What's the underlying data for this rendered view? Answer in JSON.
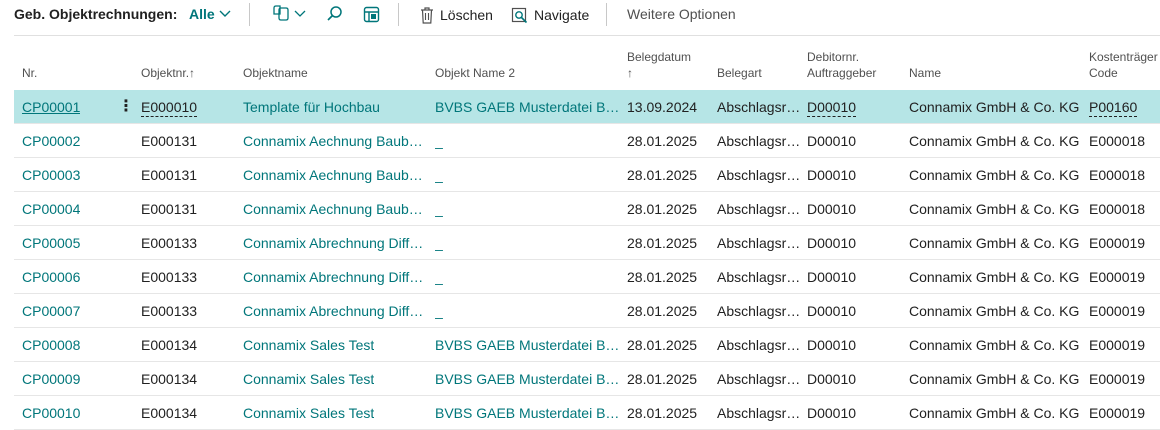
{
  "toolbar": {
    "title": "Geb. Objektrechnungen:",
    "filter_label": "Alle",
    "delete_label": "Löschen",
    "navigate_label": "Navigate",
    "more_label": "Weitere Optionen"
  },
  "columns": {
    "nr": "Nr.",
    "objektnr": "Objektnr.",
    "objektnr_arrow": "↑",
    "objektname": "Objektname",
    "objekt_name2": "Objekt Name 2",
    "belegdatum": "Belegdatum",
    "belegdatum_arrow": "↑",
    "belegart": "Belegart",
    "debitornr_line1": "Debitornr.",
    "debitornr_line2": "Auftraggeber",
    "name": "Name",
    "kostentraeger_line1": "Kostenträger",
    "kostentraeger_line2": "Code"
  },
  "rows": [
    {
      "nr": "CP00001",
      "objektnr": "E000010",
      "objektname": "Template für Hochbau",
      "name2": "BVBS GAEB Musterdatei Bau…",
      "datum": "13.09.2024",
      "belegart": "Abschlagsr…",
      "debitor": "D00010",
      "name": "Connamix GmbH & Co. KG",
      "kosten": "P00160"
    },
    {
      "nr": "CP00002",
      "objektnr": "E000131",
      "objektname": "Connamix Aechnung Baube…",
      "name2": "_",
      "datum": "28.01.2025",
      "belegart": "Abschlagsr…",
      "debitor": "D00010",
      "name": "Connamix GmbH & Co. KG",
      "kosten": "E000018"
    },
    {
      "nr": "CP00003",
      "objektnr": "E000131",
      "objektname": "Connamix Aechnung Baube…",
      "name2": "_",
      "datum": "28.01.2025",
      "belegart": "Abschlagsr…",
      "debitor": "D00010",
      "name": "Connamix GmbH & Co. KG",
      "kosten": "E000018"
    },
    {
      "nr": "CP00004",
      "objektnr": "E000131",
      "objektname": "Connamix Aechnung Baube…",
      "name2": "_",
      "datum": "28.01.2025",
      "belegart": "Abschlagsr…",
      "debitor": "D00010",
      "name": "Connamix GmbH & Co. KG",
      "kosten": "E000018"
    },
    {
      "nr": "CP00005",
      "objektnr": "E000133",
      "objektname": "Connamix Abrechnung Diffe…",
      "name2": "_",
      "datum": "28.01.2025",
      "belegart": "Abschlagsr…",
      "debitor": "D00010",
      "name": "Connamix GmbH & Co. KG",
      "kosten": "E000019"
    },
    {
      "nr": "CP00006",
      "objektnr": "E000133",
      "objektname": "Connamix Abrechnung Diffe…",
      "name2": "_",
      "datum": "28.01.2025",
      "belegart": "Abschlagsr…",
      "debitor": "D00010",
      "name": "Connamix GmbH & Co. KG",
      "kosten": "E000019"
    },
    {
      "nr": "CP00007",
      "objektnr": "E000133",
      "objektname": "Connamix Abrechnung Diffe…",
      "name2": "_",
      "datum": "28.01.2025",
      "belegart": "Abschlagsr…",
      "debitor": "D00010",
      "name": "Connamix GmbH & Co. KG",
      "kosten": "E000019"
    },
    {
      "nr": "CP00008",
      "objektnr": "E000134",
      "objektname": "Connamix Sales Test",
      "name2": "BVBS GAEB Musterdatei Bau…",
      "datum": "28.01.2025",
      "belegart": "Abschlagsr…",
      "debitor": "D00010",
      "name": "Connamix GmbH & Co. KG",
      "kosten": "E000019"
    },
    {
      "nr": "CP00009",
      "objektnr": "E000134",
      "objektname": "Connamix Sales Test",
      "name2": "BVBS GAEB Musterdatei Bau…",
      "datum": "28.01.2025",
      "belegart": "Abschlagsr…",
      "debitor": "D00010",
      "name": "Connamix GmbH & Co. KG",
      "kosten": "E000019"
    },
    {
      "nr": "CP00010",
      "objektnr": "E000134",
      "objektname": "Connamix Sales Test",
      "name2": "BVBS GAEB Musterdatei Bau…",
      "datum": "28.01.2025",
      "belegart": "Abschlagsr…",
      "debitor": "D00010",
      "name": "Connamix GmbH & Co. KG",
      "kosten": "E000019"
    }
  ],
  "selected_row": 0,
  "colors": {
    "accent": "#00767a",
    "selected": "#b6e5e6"
  }
}
